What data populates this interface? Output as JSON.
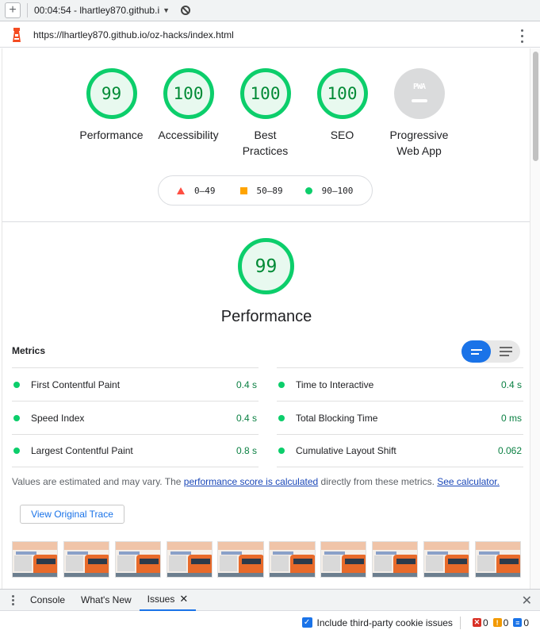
{
  "toolbar": {
    "session_label": "00:04:54 - lhartley870.github.i",
    "url": "https://lhartley870.github.io/oz-hacks/index.html"
  },
  "gauges": [
    {
      "score": "99",
      "label": "Performance"
    },
    {
      "score": "100",
      "label": "Accessibility"
    },
    {
      "score": "100",
      "label": "Best Practices"
    },
    {
      "score": "100",
      "label": "SEO"
    },
    {
      "score": "",
      "label": "Progressive Web App",
      "badge_text": "PWA"
    }
  ],
  "legend": {
    "poor": "0–49",
    "average": "50–89",
    "good": "90–100"
  },
  "performance": {
    "score": "99",
    "title": "Performance",
    "metrics_title": "Metrics",
    "left_metrics": [
      {
        "name": "First Contentful Paint",
        "value": "0.4 s"
      },
      {
        "name": "Speed Index",
        "value": "0.4 s"
      },
      {
        "name": "Largest Contentful Paint",
        "value": "0.8 s"
      }
    ],
    "right_metrics": [
      {
        "name": "Time to Interactive",
        "value": "0.4 s"
      },
      {
        "name": "Total Blocking Time",
        "value": "0 ms"
      },
      {
        "name": "Cumulative Layout Shift",
        "value": "0.062"
      }
    ],
    "note_prefix": "Values are estimated and may vary. The ",
    "note_link1": "performance score is calculated",
    "note_middle": " directly from these metrics. ",
    "note_link2": "See calculator.",
    "trace_button": "View Original Trace"
  },
  "devtools": {
    "tabs": [
      "Console",
      "What's New",
      "Issues"
    ],
    "cookie_label": "Include third-party cookie issues",
    "errors": "0",
    "warnings": "0",
    "infos": "0"
  },
  "colors": {
    "good": "#0cce6b",
    "average": "#ffa400",
    "poor": "#ff4e42",
    "accent": "#1a73e8"
  }
}
